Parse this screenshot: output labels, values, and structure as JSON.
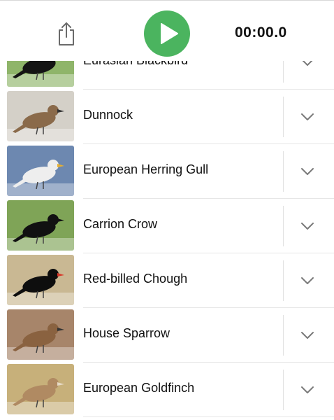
{
  "toolbar": {
    "share_icon": "share-icon",
    "play_icon": "play-icon",
    "timer": "00:00.0",
    "play_color": "#4bb45f"
  },
  "birds": [
    {
      "name": "Eurasian Blackbird",
      "bg": "#8fb56a",
      "body": "#141414",
      "beak": "#e3a21a"
    },
    {
      "name": "Dunnock",
      "bg": "#d4d0c8",
      "body": "#8a6a4a",
      "beak": "#333333"
    },
    {
      "name": "European Herring Gull",
      "bg": "#6d88b0",
      "body": "#eeeeee",
      "beak": "#e8b030"
    },
    {
      "name": "Carrion Crow",
      "bg": "#7fa457",
      "body": "#111111",
      "beak": "#111111"
    },
    {
      "name": "Red-billed Chough",
      "bg": "#c9b893",
      "body": "#0e0e0e",
      "beak": "#d8382a"
    },
    {
      "name": "House Sparrow",
      "bg": "#a7856a",
      "body": "#8a6240",
      "beak": "#333333"
    },
    {
      "name": "European Goldfinch",
      "bg": "#c7b07a",
      "body": "#b08a62",
      "beak": "#e6d9c5"
    }
  ]
}
